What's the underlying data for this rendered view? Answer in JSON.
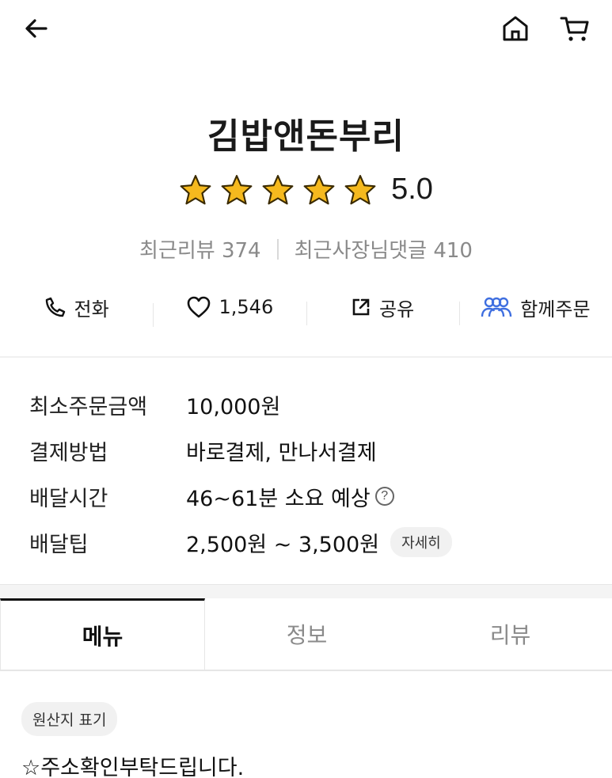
{
  "store": {
    "name": "김밥앤돈부리",
    "rating": "5.0",
    "stars": 5,
    "recent_reviews_label": "최근리뷰 374",
    "owner_replies_label": "최근사장님댓글 410"
  },
  "actions": [
    {
      "label": "전화",
      "icon": "phone-icon"
    },
    {
      "label": "1,546",
      "icon": "heart-icon"
    },
    {
      "label": "공유",
      "icon": "share-icon"
    },
    {
      "label": "함께주문",
      "icon": "group-order-icon"
    }
  ],
  "info": [
    {
      "label": "최소주문금액",
      "value": "10,000원"
    },
    {
      "label": "결제방법",
      "value": "바로결제, 만나서결제"
    },
    {
      "label": "배달시간",
      "value": "46~61분 소요 예상"
    },
    {
      "label": "배달팁",
      "value": "2,500원 ~ 3,500원"
    }
  ],
  "help_glyph": "?",
  "detail_button": "자세히",
  "tabs": [
    {
      "label": "메뉴",
      "active": true
    },
    {
      "label": "정보",
      "active": false
    },
    {
      "label": "리뷰",
      "active": false
    }
  ],
  "origin_badge": "원산지 표기",
  "notice": "☆주소확인부탁드립니다.",
  "colors": {
    "star": "#f5b91e",
    "group_order_icon": "#3f6fe0",
    "text": "#1a1a1a",
    "muted": "#8a8a8a"
  }
}
